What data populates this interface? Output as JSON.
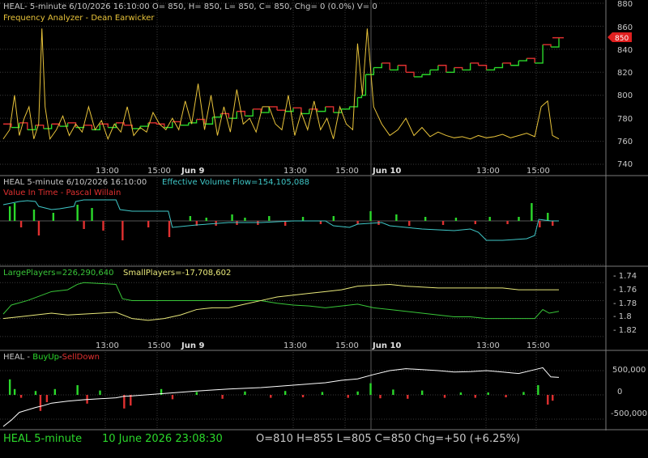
{
  "colors": {
    "background": "#000000",
    "grid": "#3a3a3a",
    "divider": "#7a7a7a",
    "axis_text": "#c8c8c8",
    "up_bar": "#2bd82b",
    "down_bar": "#e03030",
    "oscillator": "#e8c33a",
    "volume_flow": "#3fc7c7",
    "large_players": "#39c739",
    "small_players": "#e8e87a",
    "buyup_line": "#ffffff",
    "last_price_tag": "#e02020"
  },
  "panels": {
    "price": {
      "title": "HEAL- 5-minute  6/10/2026 16:10:00 O= 850, H= 850, L= 850, C= 850, Chg= 0 (0.0%) V= 0",
      "study": "Frequency Analyzer - Dean Earwicker",
      "y_ticks": [
        "880",
        "860",
        "840",
        "820",
        "800",
        "780",
        "760",
        "740"
      ],
      "last_price_tag": "850"
    },
    "volume": {
      "title": "HEAL 5-minute  6/10/2026 16:10:00",
      "flow_label": "Effective Volume Flow=154,105,088",
      "study": "Value In Time - Pascal Willain"
    },
    "players": {
      "large_label": "LargePlayers=226,290,640",
      "small_label": "SmallPlayers=-17,708,602",
      "y_ticks": [
        "- 1.74",
        "- 1.76",
        "- 1.78",
        "- 1.8",
        "- 1.82"
      ]
    },
    "buyup": {
      "title": "HEAL - ",
      "buy_label": "BuyUp",
      "sep": "-",
      "sell_label": "SellDown",
      "y_ticks": [
        "500,000",
        "0",
        "-500,000"
      ]
    }
  },
  "time_axis": {
    "labels": [
      "13:00",
      "15:00",
      "Jun 9",
      "13:00",
      "15:00",
      "Jun 10",
      "13:00",
      "15:00"
    ]
  },
  "status_bar": {
    "symbol": "HEAL  5-minute",
    "datetime": "10 June 2026 23:08:30",
    "ohlc": "O=810  H=855  L=805  C=850  Chg=+50 (+6.25%)"
  },
  "chart_data": [
    {
      "type": "line",
      "name": "price-stepped",
      "ylim": [
        740,
        880
      ],
      "x": [
        0,
        10,
        20,
        30,
        40,
        50,
        60,
        70,
        80,
        90,
        100,
        110,
        120,
        130,
        140,
        150,
        160,
        170,
        180,
        190,
        200,
        210,
        220,
        230,
        240,
        250,
        260,
        270,
        280,
        290,
        300,
        310,
        320,
        330,
        340,
        350,
        360,
        370,
        380,
        390,
        400,
        410,
        420,
        430,
        440,
        445,
        450,
        460,
        470,
        480,
        490,
        500,
        510,
        520,
        530,
        540,
        550,
        560,
        570,
        580,
        590,
        600,
        610,
        620,
        630,
        640,
        650,
        660,
        670,
        680,
        690
      ],
      "values": [
        775,
        772,
        776,
        770,
        774,
        771,
        775,
        773,
        776,
        772,
        774,
        770,
        775,
        772,
        776,
        774,
        771,
        773,
        776,
        775,
        772,
        777,
        774,
        776,
        779,
        775,
        781,
        784,
        780,
        786,
        782,
        788,
        785,
        790,
        787,
        786,
        789,
        784,
        788,
        786,
        790,
        785,
        788,
        790,
        798,
        800,
        818,
        824,
        828,
        822,
        826,
        820,
        816,
        818,
        822,
        826,
        820,
        824,
        822,
        828,
        826,
        822,
        824,
        828,
        826,
        830,
        832,
        828,
        844,
        842,
        850
      ]
    },
    {
      "type": "line",
      "name": "frequency-analyzer",
      "ylim": [
        740,
        880
      ],
      "x": [
        0,
        8,
        14,
        20,
        26,
        32,
        38,
        44,
        48,
        52,
        58,
        66,
        74,
        82,
        90,
        98,
        106,
        114,
        122,
        130,
        138,
        146,
        154,
        162,
        170,
        178,
        186,
        194,
        202,
        210,
        218,
        226,
        234,
        242,
        250,
        258,
        266,
        274,
        282,
        290,
        298,
        306,
        314,
        322,
        330,
        338,
        346,
        354,
        362,
        370,
        378,
        386,
        394,
        402,
        410,
        418,
        426,
        434,
        440,
        446,
        452,
        460,
        470,
        480,
        490,
        500,
        510,
        520,
        530,
        540,
        550,
        560,
        570,
        580,
        590,
        600,
        610,
        620,
        630,
        640,
        650,
        660,
        668,
        676,
        682,
        690
      ],
      "values": [
        762,
        770,
        800,
        765,
        780,
        790,
        762,
        775,
        858,
        790,
        762,
        770,
        782,
        765,
        775,
        768,
        790,
        770,
        778,
        762,
        775,
        768,
        790,
        765,
        772,
        768,
        785,
        775,
        770,
        780,
        770,
        795,
        775,
        810,
        770,
        800,
        765,
        790,
        768,
        805,
        775,
        780,
        768,
        790,
        790,
        775,
        770,
        800,
        765,
        785,
        770,
        795,
        770,
        780,
        762,
        790,
        775,
        770,
        845,
        800,
        858,
        790,
        775,
        765,
        770,
        780,
        765,
        772,
        764,
        768,
        765,
        763,
        764,
        762,
        765,
        763,
        764,
        766,
        763,
        765,
        767,
        764,
        790,
        795,
        765,
        762
      ]
    },
    {
      "type": "bar",
      "name": "value-in-time-bars",
      "x": [
        8,
        14,
        22,
        38,
        44,
        62,
        92,
        100,
        110,
        124,
        148,
        180,
        206,
        232,
        240,
        252,
        264,
        284,
        290,
        300,
        316,
        330,
        350,
        372,
        394,
        410,
        440,
        456,
        466,
        488,
        504,
        524,
        546,
        562,
        586,
        604,
        626,
        640,
        656,
        666,
        676,
        682
      ],
      "values": [
        18,
        22,
        -8,
        14,
        -18,
        10,
        20,
        -10,
        16,
        -12,
        -24,
        -8,
        -20,
        6,
        -6,
        4,
        -6,
        8,
        -5,
        4,
        -5,
        6,
        -6,
        5,
        -4,
        6,
        -4,
        12,
        -5,
        8,
        -6,
        5,
        -5,
        4,
        -4,
        5,
        -4,
        5,
        22,
        -8,
        10,
        -6
      ]
    },
    {
      "type": "line",
      "name": "effective-volume-flow",
      "x": [
        0,
        20,
        30,
        40,
        44,
        60,
        70,
        88,
        90,
        100,
        140,
        145,
        160,
        205,
        210,
        240,
        280,
        320,
        360,
        400,
        410,
        430,
        440,
        470,
        480,
        520,
        560,
        580,
        590,
        600,
        620,
        650,
        660,
        665,
        680,
        690
      ],
      "values": [
        20,
        24,
        25,
        24,
        18,
        14,
        15,
        18,
        24,
        26,
        26,
        14,
        12,
        12,
        -8,
        -5,
        -2,
        -2,
        0,
        0,
        -6,
        -8,
        -4,
        -2,
        -6,
        -10,
        -12,
        -10,
        -14,
        -24,
        -24,
        -22,
        -18,
        2,
        0,
        0
      ]
    },
    {
      "type": "line",
      "name": "large-players",
      "ylim": [
        -1.83,
        -1.74
      ],
      "x": [
        0,
        10,
        30,
        60,
        80,
        92,
        100,
        140,
        148,
        160,
        200,
        240,
        280,
        320,
        340,
        360,
        380,
        400,
        420,
        440,
        460,
        480,
        500,
        520,
        540,
        560,
        580,
        600,
        620,
        640,
        660,
        670,
        678,
        690
      ],
      "values": [
        -1.795,
        -1.785,
        -1.78,
        -1.77,
        -1.768,
        -1.762,
        -1.76,
        -1.762,
        -1.778,
        -1.78,
        -1.78,
        -1.78,
        -1.78,
        -1.78,
        -1.783,
        -1.785,
        -1.786,
        -1.788,
        -1.786,
        -1.784,
        -1.788,
        -1.79,
        -1.792,
        -1.794,
        -1.796,
        -1.798,
        -1.798,
        -1.8,
        -1.8,
        -1.8,
        -1.8,
        -1.79,
        -1.794,
        -1.792
      ]
    },
    {
      "type": "line",
      "name": "small-players",
      "ylim": [
        -1.83,
        -1.74
      ],
      "x": [
        0,
        20,
        40,
        60,
        80,
        100,
        140,
        160,
        180,
        200,
        220,
        240,
        260,
        280,
        300,
        320,
        340,
        360,
        380,
        400,
        420,
        440,
        460,
        480,
        500,
        520,
        540,
        560,
        580,
        600,
        620,
        640,
        660,
        690
      ],
      "values": [
        -1.8,
        -1.798,
        -1.796,
        -1.794,
        -1.796,
        -1.795,
        -1.793,
        -1.8,
        -1.802,
        -1.8,
        -1.796,
        -1.79,
        -1.788,
        -1.788,
        -1.784,
        -1.78,
        -1.776,
        -1.774,
        -1.772,
        -1.77,
        -1.768,
        -1.764,
        -1.763,
        -1.762,
        -1.764,
        -1.765,
        -1.766,
        -1.766,
        -1.766,
        -1.766,
        -1.766,
        -1.768,
        -1.768,
        -1.768
      ]
    },
    {
      "type": "bar",
      "name": "buyup-selldown-bars",
      "ylim": [
        -700000,
        800000
      ],
      "x": [
        8,
        14,
        22,
        40,
        46,
        54,
        64,
        92,
        104,
        120,
        150,
        158,
        196,
        210,
        240,
        272,
        300,
        332,
        350,
        372,
        396,
        428,
        440,
        456,
        468,
        484,
        502,
        520,
        548,
        568,
        586,
        602,
        624,
        646,
        664,
        676,
        682
      ],
      "values": [
        320000,
        120000,
        -60000,
        80000,
        -330000,
        -150000,
        120000,
        200000,
        -180000,
        90000,
        -280000,
        -220000,
        120000,
        -90000,
        60000,
        -80000,
        70000,
        -60000,
        80000,
        -50000,
        60000,
        -60000,
        70000,
        240000,
        -70000,
        110000,
        -80000,
        90000,
        -60000,
        50000,
        -60000,
        50000,
        -50000,
        60000,
        200000,
        -200000,
        -120000
      ]
    },
    {
      "type": "line",
      "name": "buyup-cumulative",
      "ylim": [
        -700000,
        800000
      ],
      "x": [
        0,
        10,
        20,
        40,
        50,
        60,
        80,
        100,
        120,
        140,
        150,
        160,
        200,
        240,
        280,
        320,
        360,
        400,
        420,
        440,
        460,
        480,
        500,
        520,
        540,
        560,
        580,
        600,
        620,
        640,
        660,
        670,
        680,
        690
      ],
      "values": [
        -650000,
        -520000,
        -360000,
        -260000,
        -220000,
        -170000,
        -130000,
        -100000,
        -80000,
        -60000,
        -30000,
        -20000,
        30000,
        80000,
        120000,
        150000,
        200000,
        250000,
        300000,
        330000,
        420000,
        500000,
        540000,
        520000,
        500000,
        470000,
        480000,
        500000,
        470000,
        440000,
        520000,
        560000,
        370000,
        360000
      ]
    }
  ]
}
